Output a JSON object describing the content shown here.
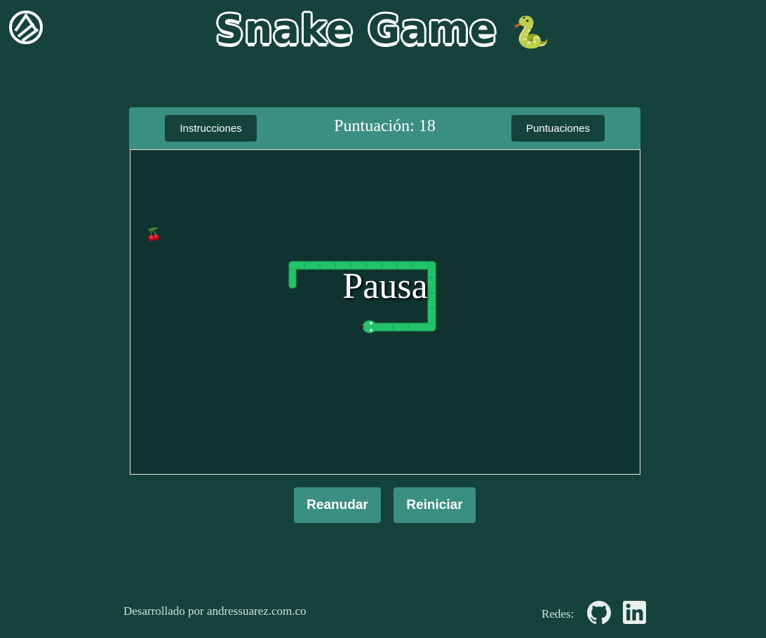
{
  "header": {
    "title": "Snake Game",
    "title_emoji": "🐍",
    "logo_icon": "asd-logo-icon"
  },
  "game": {
    "instructions_label": "Instrucciones",
    "score_text": "Puntuación: 18",
    "scores_label": "Puntuaciones",
    "pause_text": "Pausa",
    "food_emoji": "🍒",
    "snake_color": "#22c36a"
  },
  "controls": {
    "resume_label": "Reanudar",
    "restart_label": "Reiniciar"
  },
  "footer": {
    "credit": "Desarrollado por andressuarez.com.co",
    "redes_label": "Redes:",
    "github_icon": "github-icon",
    "linkedin_icon": "linkedin-icon"
  },
  "colors": {
    "background": "#16423c",
    "accent": "#3b8f82",
    "board": "#113330"
  }
}
